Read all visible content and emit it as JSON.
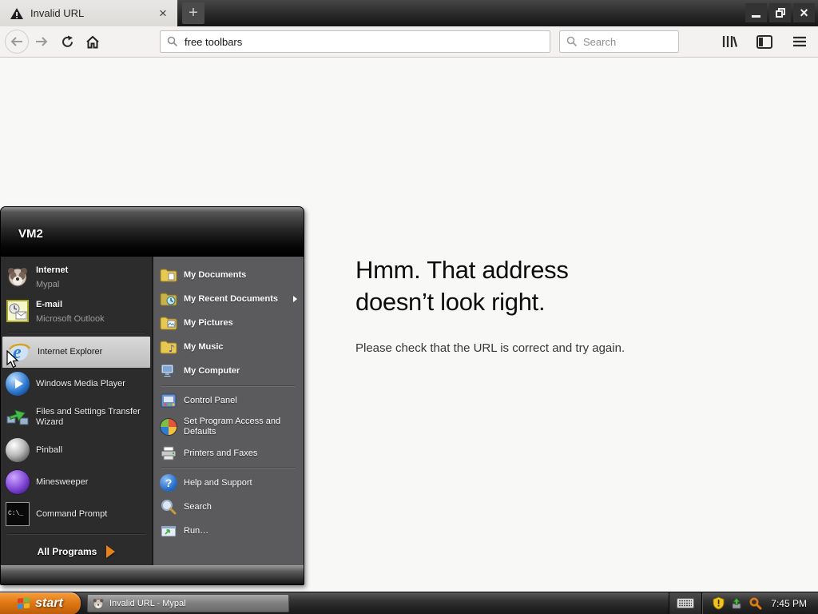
{
  "browser": {
    "tab": {
      "title": "Invalid URL",
      "close_glyph": "×",
      "icon": "warning-icon"
    },
    "new_tab_glyph": "+",
    "window_controls": {
      "close_glyph": "×"
    },
    "toolbar": {
      "url_value": "free toolbars",
      "search_placeholder": "Search"
    }
  },
  "error_page": {
    "title": "Hmm. That address doesn’t look right.",
    "message": "Please check that the URL is correct and try again."
  },
  "start_menu": {
    "user": "VM2",
    "left_items": [
      {
        "label": "Internet",
        "sublabel": "Mypal",
        "icon": "mypal-icon"
      },
      {
        "label": "E-mail",
        "sublabel": "Microsoft Outlook",
        "icon": "outlook-icon"
      },
      {
        "label": "Internet Explorer",
        "icon": "internet-explorer-icon",
        "selected": true
      },
      {
        "label": "Windows Media Player",
        "icon": "media-player-icon"
      },
      {
        "label": "Files and Settings Transfer Wizard",
        "icon": "transfer-wizard-icon"
      },
      {
        "label": "Pinball",
        "icon": "pinball-icon"
      },
      {
        "label": "Minesweeper",
        "icon": "minesweeper-icon"
      },
      {
        "label": "Command Prompt",
        "icon": "command-prompt-icon"
      }
    ],
    "all_programs_label": "All Programs",
    "right_items": [
      {
        "label": "My Documents",
        "icon": "my-documents-icon"
      },
      {
        "label": "My Recent Documents",
        "icon": "recent-documents-icon",
        "submenu": true
      },
      {
        "label": "My Pictures",
        "icon": "my-pictures-icon"
      },
      {
        "label": "My Music",
        "icon": "my-music-icon"
      },
      {
        "label": "My Computer",
        "icon": "my-computer-icon"
      },
      {
        "label": "Control Panel",
        "icon": "control-panel-icon"
      },
      {
        "label": "Set Program Access and Defaults",
        "icon": "program-access-icon"
      },
      {
        "label": "Printers and Faxes",
        "icon": "printers-icon"
      },
      {
        "label": "Help and Support",
        "icon": "help-icon"
      },
      {
        "label": "Search",
        "icon": "search-icon"
      },
      {
        "label": "Run…",
        "icon": "run-icon"
      }
    ],
    "icon_glyphs": {
      "cmd_text": "C:\\_",
      "help_mark": "?",
      "music_note": "♪"
    }
  },
  "taskbar": {
    "start_label": "start",
    "task_label": "Invalid URL - Mypal",
    "clock": "7:45 PM"
  }
}
